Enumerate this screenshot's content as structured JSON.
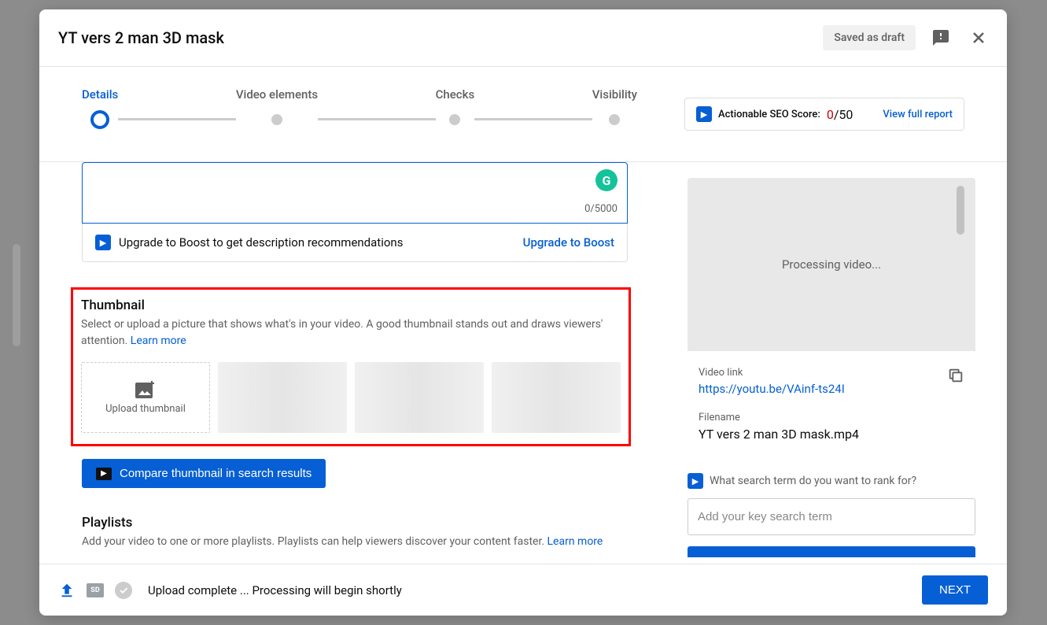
{
  "header": {
    "title": "YT vers 2 man 3D mask",
    "saved_badge": "Saved as draft"
  },
  "stepper": {
    "steps": [
      "Details",
      "Video elements",
      "Checks",
      "Visibility"
    ]
  },
  "seo": {
    "label": "Actionable SEO Score:",
    "score": "0",
    "total": "/50",
    "link": "View full report"
  },
  "description": {
    "char_count": "0/5000",
    "upgrade_text": "Upgrade to Boost to get description recommendations",
    "upgrade_link": "Upgrade to Boost"
  },
  "thumbnail": {
    "title": "Thumbnail",
    "desc": "Select or upload a picture that shows what's in your video. A good thumbnail stands out and draws viewers' attention. ",
    "learn_more": "Learn more",
    "upload_label": "Upload thumbnail",
    "compare_btn": "Compare thumbnail in search results"
  },
  "playlists": {
    "title": "Playlists",
    "desc": "Add your video to one or more playlists. Playlists can help viewers discover your content faster. ",
    "learn_more": "Learn more"
  },
  "sidebar": {
    "processing": "Processing video...",
    "link_label": "Video link",
    "link_url": "https://youtu.be/VAinf-ts24I",
    "filename_label": "Filename",
    "filename": "YT vers 2 man 3D mask.mp4",
    "search_prompt": "What search term do you want to rank for?",
    "search_placeholder": "Add your key search term"
  },
  "footer": {
    "status": "Upload complete ... Processing will begin shortly",
    "next": "NEXT",
    "sd": "SD"
  }
}
